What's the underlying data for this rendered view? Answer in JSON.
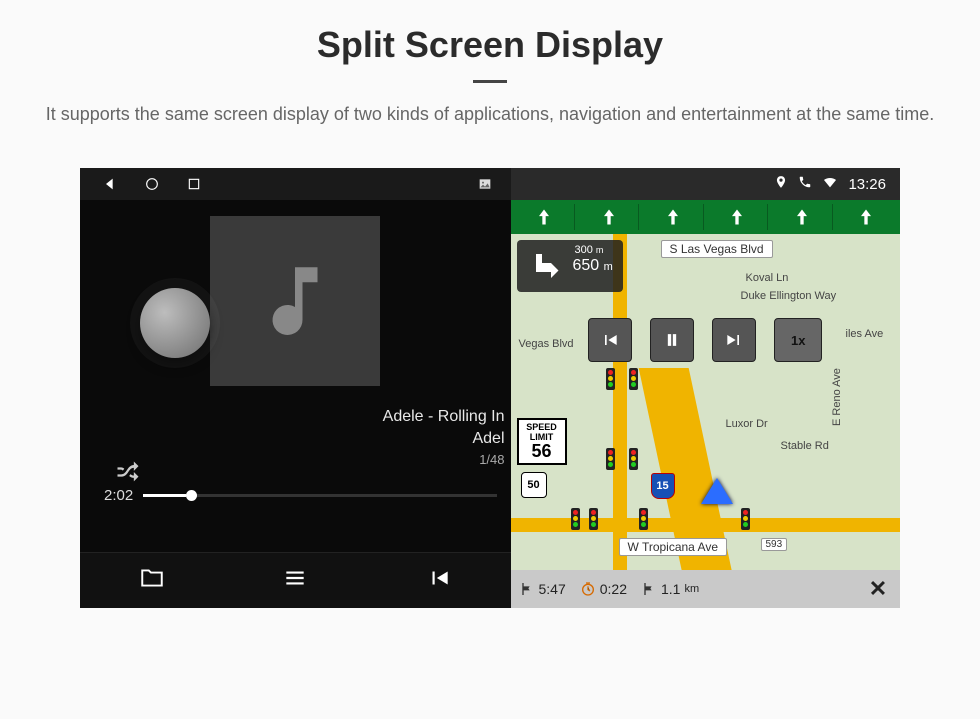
{
  "page": {
    "title": "Split Screen Display",
    "subtitle": "It supports the same screen display of two kinds of applications, navigation and entertainment at the same time."
  },
  "statusbar": {
    "clock": "13:26"
  },
  "music": {
    "track_line1": "Adele - Rolling In",
    "track_line2": "Adel",
    "track_index": "1/48",
    "elapsed": "2:02"
  },
  "nav": {
    "turn_distance": "650",
    "turn_unit": "m",
    "ahead_distance": "300",
    "ahead_unit": "m",
    "speed_limit_label": "SPEED LIMIT",
    "speed_limit_value": "56",
    "speed_multiplier": "1x",
    "labels": {
      "s_las_vegas": "S Las Vegas Blvd",
      "koval": "Koval Ln",
      "duke": "Duke Ellington Way",
      "vegas_blvd": "Vegas Blvd",
      "luxor": "Luxor Dr",
      "stable": "Stable Rd",
      "reno": "E Reno Ave",
      "tropicana": "W Tropicana Ave",
      "tropicana_num": "593",
      "miles": "iles Ave"
    },
    "shields": {
      "us50": "50",
      "i15": "15"
    },
    "footer": {
      "eta": "5:47",
      "time_remaining": "0:22",
      "distance": "1.1",
      "distance_unit": "km"
    }
  }
}
